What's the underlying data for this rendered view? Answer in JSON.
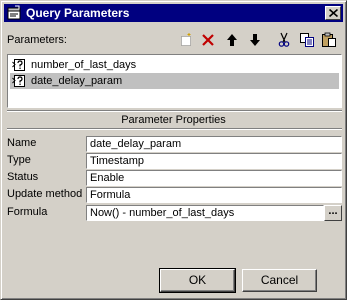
{
  "window": {
    "title": "Query Parameters",
    "title_icon": "query-parameters-icon",
    "close_icon": "close-icon"
  },
  "parameters": {
    "label": "Parameters:",
    "toolbar": [
      {
        "name": "new-parameter-button",
        "icon": "new-icon"
      },
      {
        "name": "delete-parameter-button",
        "icon": "delete-icon"
      },
      {
        "name": "move-up-button",
        "icon": "arrow-up-icon"
      },
      {
        "name": "move-down-button",
        "icon": "arrow-down-icon"
      },
      {
        "name": "cut-button",
        "icon": "scissors-icon"
      },
      {
        "name": "copy-button",
        "icon": "copy-icon"
      },
      {
        "name": "paste-button",
        "icon": "paste-icon"
      }
    ],
    "items": [
      {
        "label": "number_of_last_days",
        "selected": false
      },
      {
        "label": "date_delay_param",
        "selected": true
      }
    ]
  },
  "properties": {
    "section_title": "Parameter Properties",
    "fields": [
      {
        "label": "Name",
        "value": "date_delay_param"
      },
      {
        "label": "Type",
        "value": "Timestamp"
      },
      {
        "label": "Status",
        "value": "Enable"
      },
      {
        "label": "Update method",
        "value": "Formula"
      },
      {
        "label": "Formula",
        "value": "Now() - number_of_last_days"
      }
    ],
    "ellipsis_label": "..."
  },
  "buttons": {
    "ok": "OK",
    "cancel": "Cancel"
  }
}
